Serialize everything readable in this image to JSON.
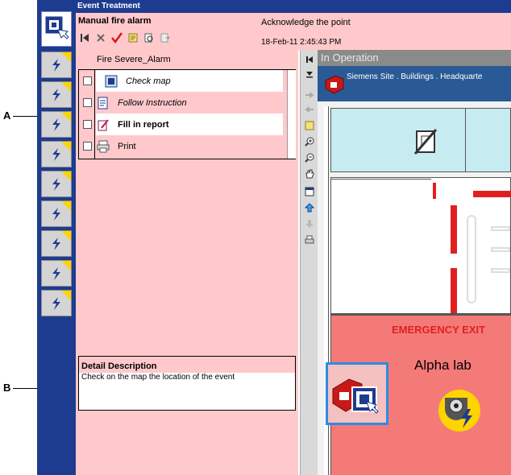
{
  "callouts": {
    "a": "A",
    "b": "B"
  },
  "window": {
    "title": "Event Treatment"
  },
  "header": {
    "alarm_title": "Manual fire alarm",
    "acknowledge_text": "Acknowledge the point",
    "timestamp": "18-Feb-11  2:45:43 PM"
  },
  "steps": {
    "header": "Fire Severe_Alarm",
    "items": [
      {
        "label": "Check map",
        "style": "italic"
      },
      {
        "label": "Follow Instruction",
        "style": "italic"
      },
      {
        "label": "Fill in report",
        "style": "bold"
      },
      {
        "label": "Print",
        "style": "normal"
      }
    ]
  },
  "detail": {
    "title": "Detail Description",
    "text": "Check on the map the location of the event"
  },
  "map": {
    "status": "In Operation",
    "breadcrumb": "Siemens Site . Buildings . Headquarte",
    "emergency_label": "EMERGENCY EXIT",
    "room_label": "Alpha lab"
  },
  "colors": {
    "rail_blue": "#1d3b8f",
    "panel_pink": "#ffc9cc",
    "room_red": "#f47a78",
    "selection_blue": "#2d8be6",
    "alarm_yellow": "#ffd400"
  }
}
